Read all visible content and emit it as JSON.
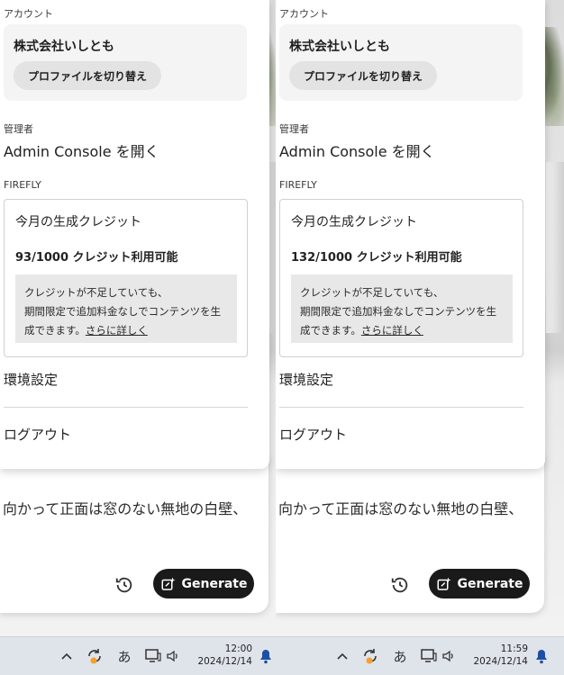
{
  "panels": [
    {
      "account_label": "アカウント",
      "company_name": "株式会社いしとも",
      "switch_profile_label": "プロファイルを切り替え",
      "admin_label": "管理者",
      "admin_console_link": "Admin Console を開く",
      "firefly_label": "FIREFLY",
      "credit_title": "今月の生成クレジット",
      "credit_count": "93/1000 クレジット利用可能",
      "credit_note_line1": "クレジットが不足していても、",
      "credit_note_line2": "期間限定で追加料金なしでコンテンツを生",
      "credit_note_line3": "成できます。",
      "learn_more_link": "さらに詳しく",
      "preferences_label": "環境設定",
      "logout_label": "ログアウト",
      "prompt_text": "向かって正面は窓のない無地の白壁、",
      "generate_label": "Generate",
      "taskbar": {
        "time": "12:00",
        "date": "2024/12/14",
        "ime": "あ"
      }
    },
    {
      "account_label": "アカウント",
      "company_name": "株式会社いしとも",
      "switch_profile_label": "プロファイルを切り替え",
      "admin_label": "管理者",
      "admin_console_link": "Admin Console を開く",
      "firefly_label": "FIREFLY",
      "credit_title": "今月の生成クレジット",
      "credit_count": "132/1000 クレジット利用可能",
      "credit_note_line1": "クレジットが不足していても、",
      "credit_note_line2": "期間限定で追加料金なしでコンテンツを生",
      "credit_note_line3": "成できます。",
      "learn_more_link": "さらに詳しく",
      "preferences_label": "環境設定",
      "logout_label": "ログアウト",
      "prompt_text": "向かって正面は窓のない無地の白壁、",
      "generate_label": "Generate",
      "taskbar": {
        "time": "11:59",
        "date": "2024/12/14",
        "ime": "あ"
      }
    }
  ],
  "colors": {
    "generate_button_bg": "#1a1a1a",
    "note_bg": "#e8e8e8",
    "taskbar_bg": "#dfe3ea",
    "bell": "#1d4fa6",
    "sync_badge": "#f2a12a"
  },
  "icons": [
    "history-icon",
    "generate-sparkle-icon",
    "chevron-up-icon",
    "sync-icon",
    "display-icon",
    "speaker-icon",
    "notification-bell-icon"
  ]
}
